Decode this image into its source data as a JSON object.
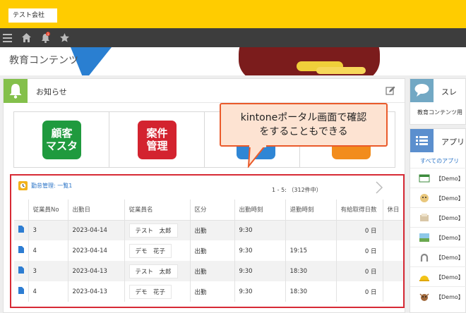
{
  "header": {
    "company": "テスト会社"
  },
  "nav": {
    "badge": "1"
  },
  "hero": {
    "title": "教育コンテンツ"
  },
  "notice": {
    "title": "お知らせ"
  },
  "tiles": [
    {
      "line1": "顧客",
      "line2": "マスタ",
      "color": "#1f9a3e"
    },
    {
      "line1": "案件",
      "line2": "管理",
      "color": "#d3232f"
    },
    {
      "line1": "",
      "line2": "",
      "color": "#2f86d5"
    },
    {
      "line1": "",
      "line2": "",
      "color": "#f28c1c"
    }
  ],
  "callout": {
    "line1": "kintoneポータル画面で確認",
    "line2": "をすることもできる"
  },
  "grid": {
    "link": "勤怠管理: 一覧1",
    "count": "1 - 5: （312件中）",
    "columns": [
      "",
      "従業員No",
      "出勤日",
      "従業員名",
      "区分",
      "出勤時刻",
      "退勤時刻",
      "有給取得日数",
      "休日"
    ],
    "rows": [
      {
        "no": "3",
        "date": "2023-04-14",
        "name": "テスト　太郎",
        "kubun": "出勤",
        "in": "9:30",
        "out": "",
        "paid": "0 日"
      },
      {
        "no": "4",
        "date": "2023-04-14",
        "name": "デモ　花子",
        "kubun": "出勤",
        "in": "9:30",
        "out": "19:15",
        "paid": "0 日"
      },
      {
        "no": "3",
        "date": "2023-04-13",
        "name": "テスト　太郎",
        "kubun": "出勤",
        "in": "9:30",
        "out": "18:30",
        "paid": "0 日"
      },
      {
        "no": "4",
        "date": "2023-04-13",
        "name": "デモ　花子",
        "kubun": "出勤",
        "in": "9:30",
        "out": "18:30",
        "paid": "0 日"
      }
    ]
  },
  "space": {
    "title": "スレ",
    "body": "教育コンテンツ用"
  },
  "apps": {
    "title": "アプリ",
    "link": "すべてのアプリ",
    "items": [
      {
        "label": "【Demo】"
      },
      {
        "label": "【Demo】"
      },
      {
        "label": "【Demo】"
      },
      {
        "label": "【Demo】"
      },
      {
        "label": "【Demo】"
      },
      {
        "label": "【Demo】"
      },
      {
        "label": "【Demo】"
      }
    ]
  }
}
